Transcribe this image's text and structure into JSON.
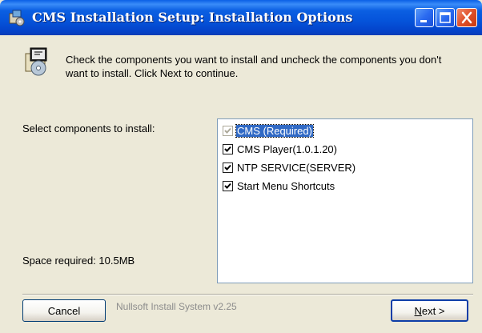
{
  "window": {
    "title": "CMS Installation Setup: Installation Options",
    "icons": [
      "app-icon",
      "minimize-icon",
      "maximize-icon",
      "close-icon"
    ]
  },
  "header": {
    "description": "Check the components you want to install and uncheck the components you don't want to install. Click Next to continue.",
    "icon": "setup-package-icon"
  },
  "components": {
    "label": "Select components to install:",
    "items": [
      {
        "label": "CMS (Required)",
        "checked": true,
        "disabled": true,
        "selected": true
      },
      {
        "label": "CMS Player(1.0.1.20)",
        "checked": true,
        "disabled": false,
        "selected": false
      },
      {
        "label": "NTP SERVICE(SERVER)",
        "checked": true,
        "disabled": false,
        "selected": false
      },
      {
        "label": "Start Menu Shortcuts",
        "checked": true,
        "disabled": false,
        "selected": false
      }
    ]
  },
  "space_required": "Space required: 10.5MB",
  "footer": {
    "branding": "Nullsoft Install System v2.25",
    "cancel_label": "Cancel",
    "next_label_accel": "N",
    "next_label_rest": "ext >"
  },
  "colors": {
    "titlebar": "#0553da",
    "dialog_bg": "#ece9d8",
    "selection": "#316ac5",
    "close_button": "#e0502a"
  }
}
